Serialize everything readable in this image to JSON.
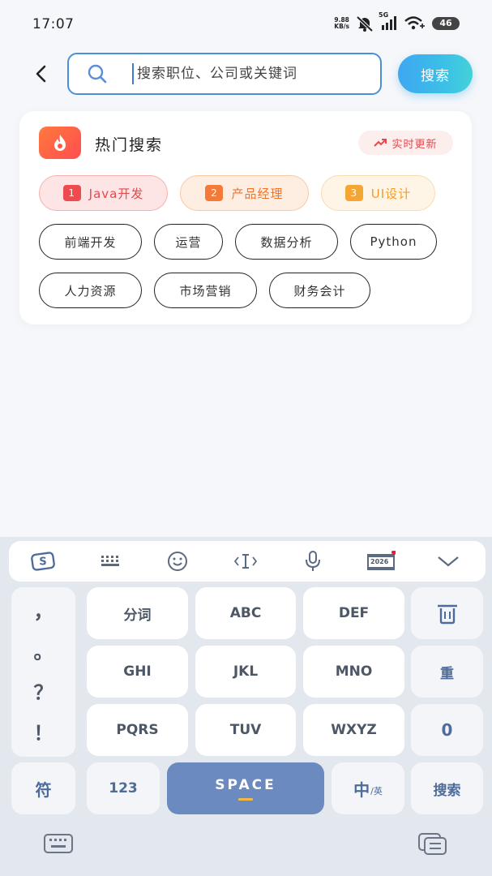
{
  "status_bar": {
    "time": "17:07",
    "net_speed_value": "9.88",
    "net_speed_unit": "KB/s",
    "network_type": "5G",
    "battery": "46"
  },
  "header": {
    "search_placeholder": "搜索职位、公司或关键词",
    "search_button": "搜索"
  },
  "hot_search": {
    "title": "热门搜索",
    "realtime_label": "实时更新",
    "ranked": [
      {
        "rank": "1",
        "label": "Java开发"
      },
      {
        "rank": "2",
        "label": "产品经理"
      },
      {
        "rank": "3",
        "label": "UI设计"
      }
    ],
    "tags": [
      "前端开发",
      "运营",
      "数据分析",
      "Python",
      "人力资源",
      "市场营销",
      "财务会计"
    ]
  },
  "keyboard": {
    "calendar_year": "2026",
    "punctuation": [
      "，",
      "。",
      "？",
      "！"
    ],
    "row1": [
      "分词",
      "ABC",
      "DEF"
    ],
    "row2": [
      "GHI",
      "JKL",
      "MNO"
    ],
    "row3": [
      "PQRS",
      "TUV",
      "WXYZ"
    ],
    "retype": "重",
    "zero": "0",
    "symbols": "符",
    "numbers": "123",
    "space": "SPACE",
    "lang_main": "中",
    "lang_sub": "/英",
    "search": "搜索"
  },
  "colors": {
    "accent_blue": "#4a90d9",
    "hot_red": "#ee4b4f",
    "hot_orange": "#f37a38",
    "hot_yellow": "#f5a533",
    "space_key": "#6a8ac0"
  }
}
